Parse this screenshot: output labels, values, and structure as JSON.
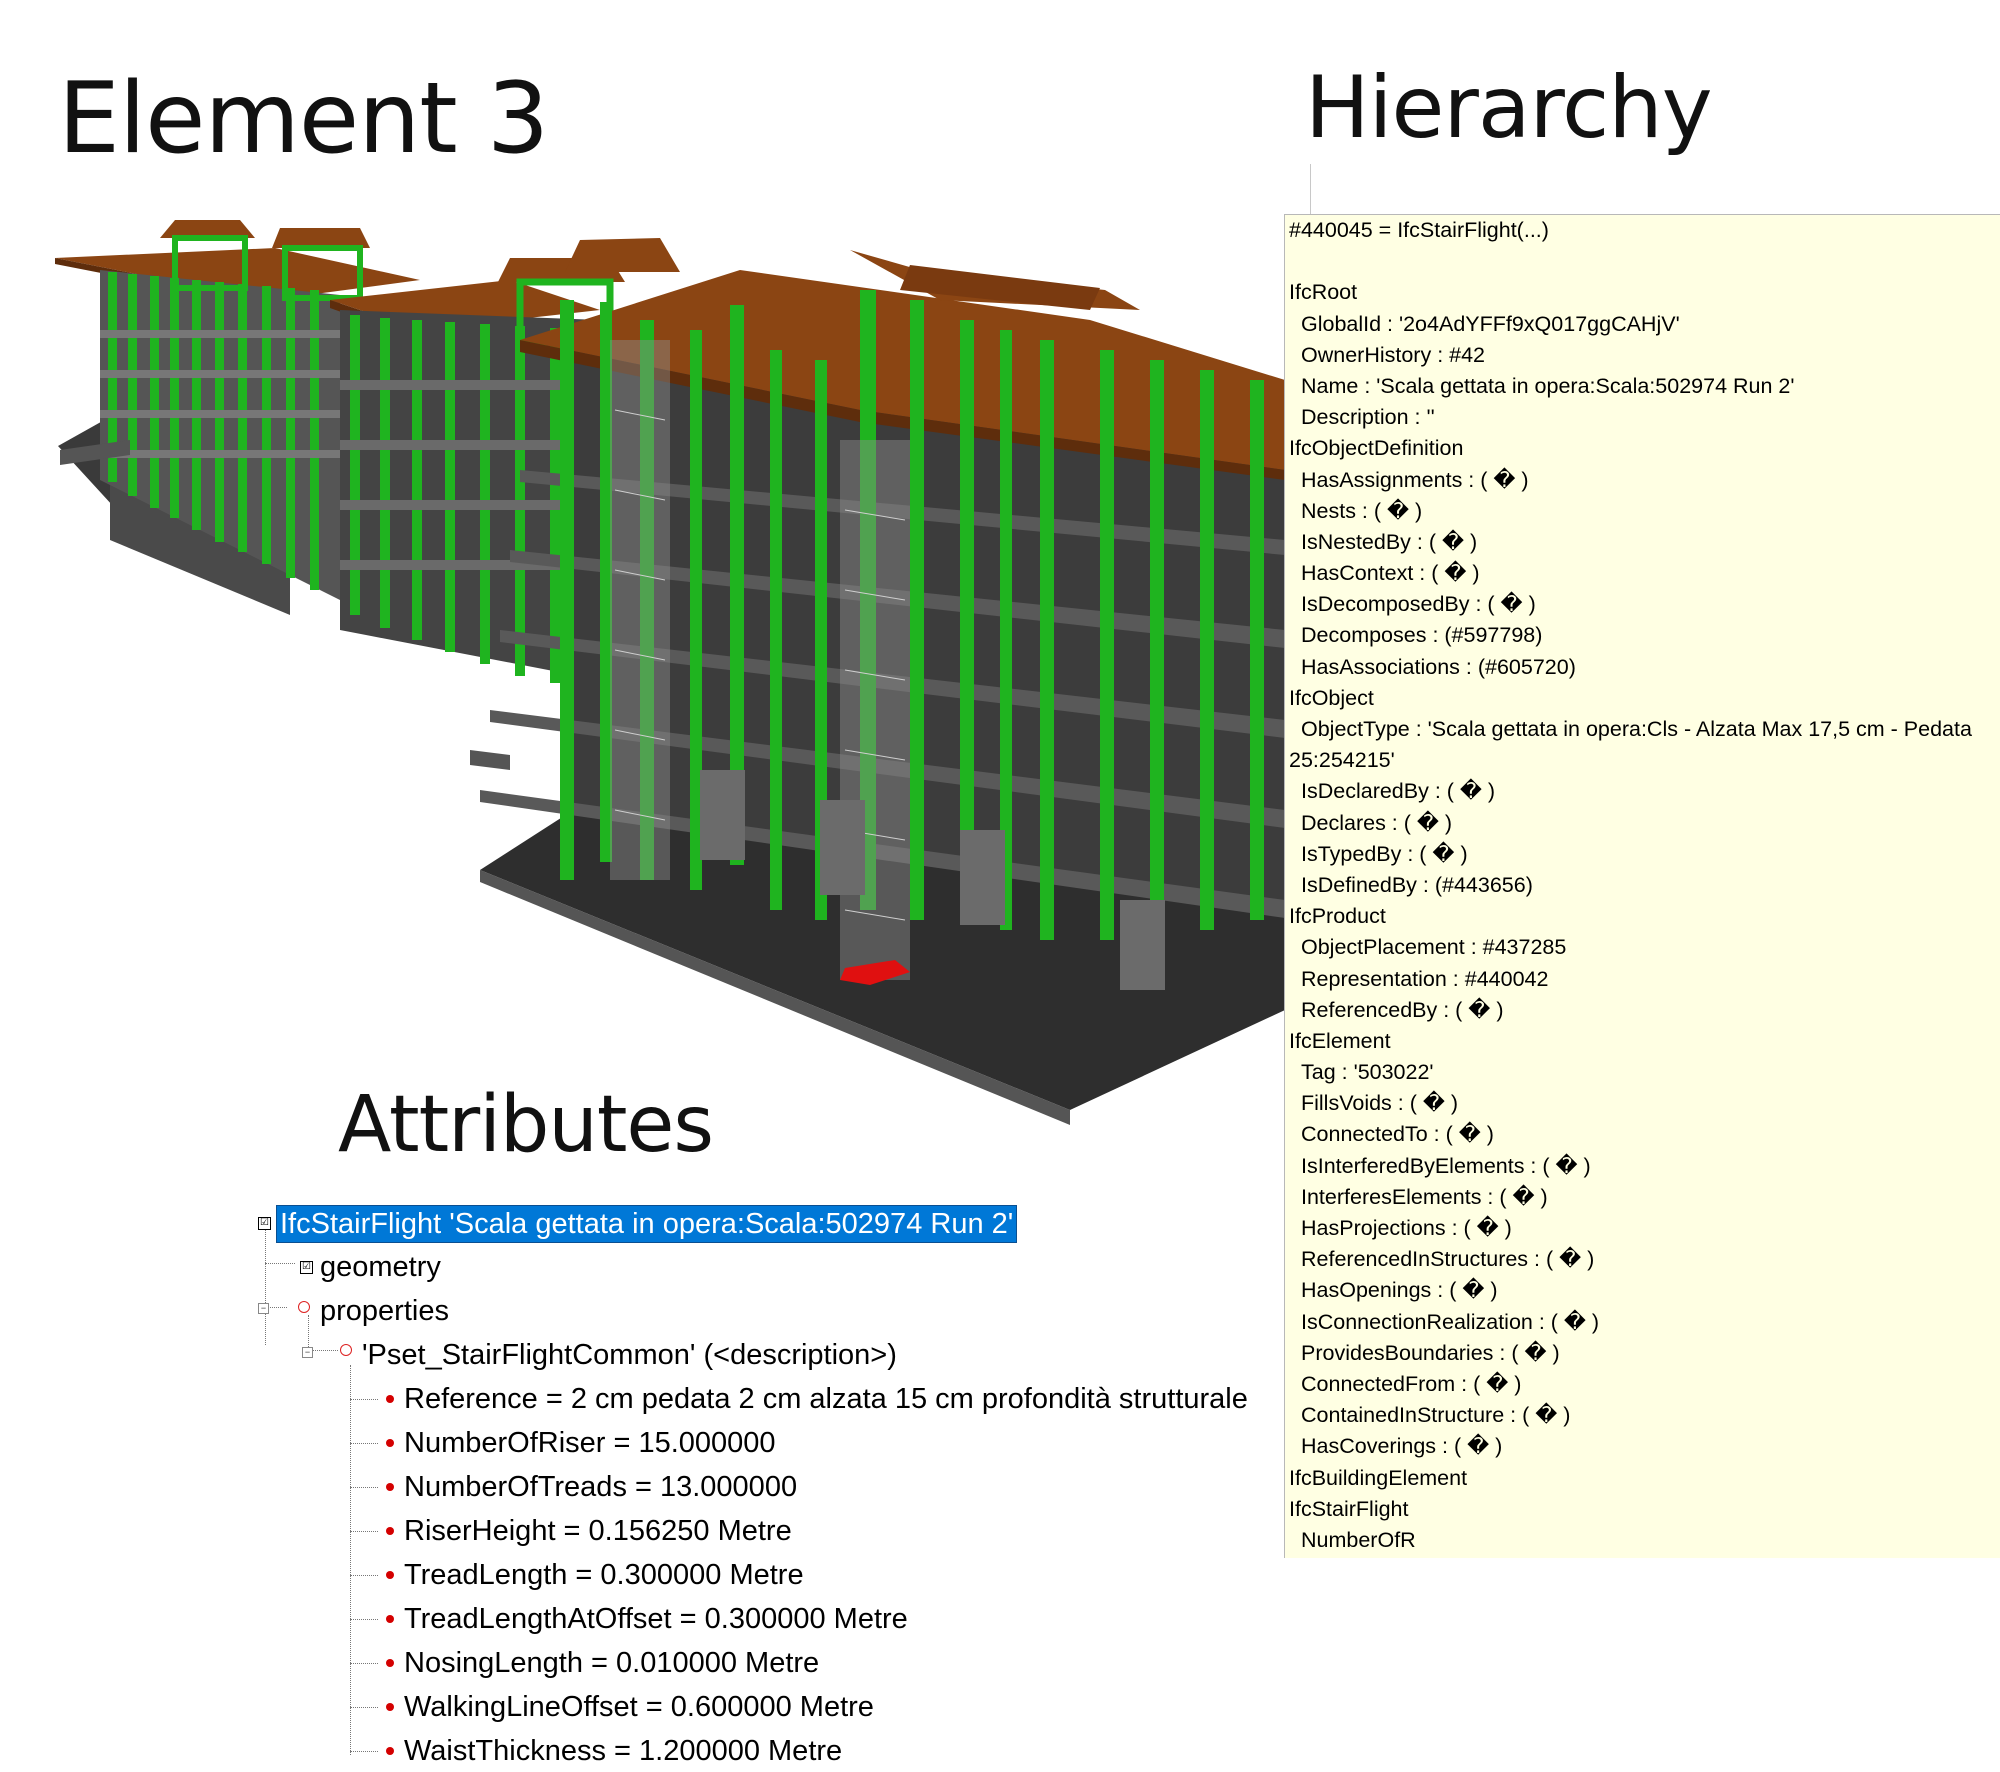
{
  "headings": {
    "element": "Element 3",
    "hierarchy": "Hierarchy",
    "attributes": "Attributes"
  },
  "colors": {
    "columns": "#1fb41f",
    "roof": "#8b4513",
    "slabs": "#3c3c3c",
    "selected_stair": "#e01010",
    "hierarchy_bg": "#ffffe3",
    "selection": "#0078d7"
  },
  "hierarchy": {
    "lines": [
      {
        "text": "#440045 = IfcStairFlight(...)",
        "indent": false
      },
      {
        "text": "",
        "indent": false
      },
      {
        "text": "IfcRoot",
        "indent": false
      },
      {
        "text": "GlobalId : '2o4AdYFFf9xQ017ggCAHjV'",
        "indent": true
      },
      {
        "text": "OwnerHistory : #42",
        "indent": true
      },
      {
        "text": "Name : 'Scala gettata in opera:Scala:502974 Run 2'",
        "indent": true
      },
      {
        "text": "Description : ''",
        "indent": true
      },
      {
        "text": "IfcObjectDefinition",
        "indent": false
      },
      {
        "text": "HasAssignments : ( � )",
        "indent": true
      },
      {
        "text": "Nests : ( � )",
        "indent": true
      },
      {
        "text": "IsNestedBy : ( � )",
        "indent": true
      },
      {
        "text": "HasContext : ( � )",
        "indent": true
      },
      {
        "text": "IsDecomposedBy : ( � )",
        "indent": true
      },
      {
        "text": "Decomposes : (#597798)",
        "indent": true
      },
      {
        "text": "HasAssociations : (#605720)",
        "indent": true
      },
      {
        "text": "IfcObject",
        "indent": false
      },
      {
        "text": "ObjectType : 'Scala gettata in opera:Cls - Alzata Max 17,5 cm - Pedata",
        "indent": true
      },
      {
        "text": "25:254215'",
        "indent": false
      },
      {
        "text": "IsDeclaredBy : ( � )",
        "indent": true
      },
      {
        "text": "Declares : ( � )",
        "indent": true
      },
      {
        "text": "IsTypedBy : ( � )",
        "indent": true
      },
      {
        "text": "IsDefinedBy : (#443656)",
        "indent": true
      },
      {
        "text": "IfcProduct",
        "indent": false
      },
      {
        "text": "ObjectPlacement : #437285",
        "indent": true
      },
      {
        "text": "Representation : #440042",
        "indent": true
      },
      {
        "text": "ReferencedBy : ( � )",
        "indent": true
      },
      {
        "text": "IfcElement",
        "indent": false
      },
      {
        "text": "Tag : '503022'",
        "indent": true
      },
      {
        "text": "FillsVoids : ( � )",
        "indent": true
      },
      {
        "text": "ConnectedTo : ( � )",
        "indent": true
      },
      {
        "text": "IsInterferedByElements : ( � )",
        "indent": true
      },
      {
        "text": "InterferesElements : ( � )",
        "indent": true
      },
      {
        "text": "HasProjections : ( � )",
        "indent": true
      },
      {
        "text": "ReferencedInStructures : ( � )",
        "indent": true
      },
      {
        "text": "HasOpenings : ( � )",
        "indent": true
      },
      {
        "text": "IsConnectionRealization : ( � )",
        "indent": true
      },
      {
        "text": "ProvidesBoundaries : ( � )",
        "indent": true
      },
      {
        "text": "ConnectedFrom : ( � )",
        "indent": true
      },
      {
        "text": "ContainedInStructure : ( � )",
        "indent": true
      },
      {
        "text": "HasCoverings : ( � )",
        "indent": true
      },
      {
        "text": "IfcBuildingElement",
        "indent": false
      },
      {
        "text": "IfcStairFlight",
        "indent": false
      },
      {
        "text": "NumberOfR",
        "indent": true
      }
    ]
  },
  "tree": {
    "root": "IfcStairFlight 'Scala gettata in opera:Scala:502974 Run 2'",
    "geometry": "geometry",
    "properties": "properties",
    "pset": "'Pset_StairFlightCommon' (<description>)",
    "props": [
      "Reference = 2 cm pedata 2 cm alzata 15 cm profondità strutturale",
      "NumberOfRiser = 15.000000",
      "NumberOfTreads = 13.000000",
      "RiserHeight = 0.156250 Metre",
      "TreadLength = 0.300000 Metre",
      "TreadLengthAtOffset = 0.300000 Metre",
      "NosingLength = 0.010000 Metre",
      "WalkingLineOffset = 0.600000 Metre",
      "WaistThickness = 1.200000 Metre"
    ]
  }
}
